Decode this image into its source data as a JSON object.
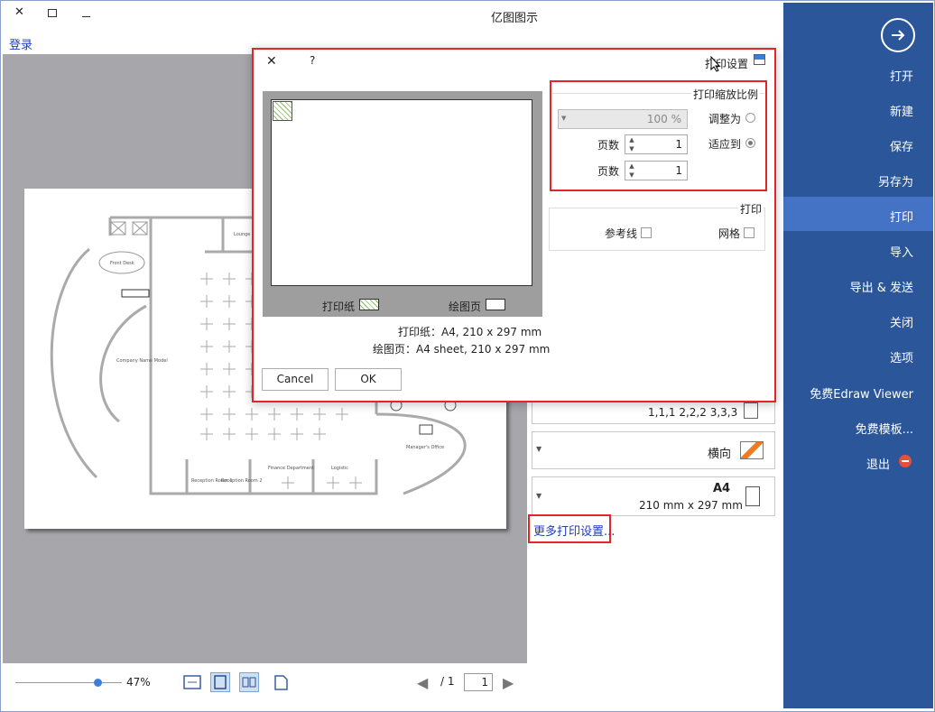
{
  "window": {
    "title": "亿图图示",
    "login": "登录",
    "minimize_glyph": "–",
    "maximize_glyph": "☐",
    "close_glyph": "✕"
  },
  "sidebar": {
    "items": [
      {
        "label": "打开"
      },
      {
        "label": "新建"
      },
      {
        "label": "保存"
      },
      {
        "label": "另存为"
      },
      {
        "label": "打印",
        "active": true
      },
      {
        "label": "导入"
      },
      {
        "label": "导出 & 发送"
      },
      {
        "label": "关闭"
      },
      {
        "label": "选项"
      },
      {
        "label": "免费Edraw Viewer"
      },
      {
        "label": "免费模板..."
      },
      {
        "label": "退出"
      }
    ],
    "colors": {
      "background": "#2b579a",
      "active": "#4472c4",
      "exit_icon": "#e84d3d"
    }
  },
  "floorplan": {
    "labels": [
      "Front Desk",
      "Company Name Model",
      "Lounge",
      "Finance Department",
      "Reception Room 1",
      "Reception Room 2",
      "Logistic",
      "Manager's Office"
    ]
  },
  "bottom_bar": {
    "zoom": "47%",
    "zoom_fraction": 0.47,
    "page_current": "1",
    "page_total": "/ 1"
  },
  "right_panel": {
    "collate": "1,1,1  2,2,2  3,3,3",
    "orientation": "横向",
    "paper_size_name": "A4",
    "paper_size_dims": "210 mm x 297 mm",
    "more_settings": "更多打印设置..."
  },
  "dialog": {
    "title": "打印设置",
    "help_glyph": "?",
    "close_glyph": "✕",
    "legend_draw_page": "绘图页",
    "legend_print_paper": "打印纸",
    "paper_info": "打印纸：A4, 210 x 297 mm",
    "draw_page_info": "绘图页：A4 sheet, 210 x 297 mm",
    "ok_label": "OK",
    "cancel_label": "Cancel",
    "scale_group_title": "打印缩放比例",
    "adjust_label": "调整为",
    "adjust_value": "100 %",
    "fit_label": "适应到",
    "fit_pages_1": "1",
    "fit_pages_2": "1",
    "pages_label_1": "页数",
    "pages_label_2": "页数",
    "print_group_title": "打印",
    "grid_label": "网格",
    "guides_label": "参考线",
    "colors": {
      "outline": "#e3252b",
      "preview_bg": "#9e9e9e",
      "hatch": "#8ec16a"
    }
  }
}
